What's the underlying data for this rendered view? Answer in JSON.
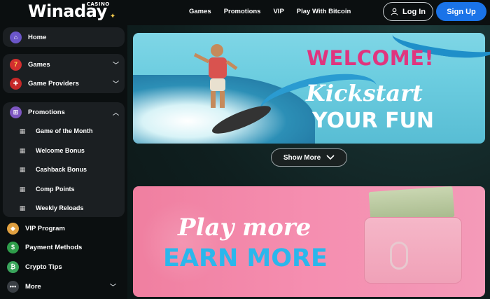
{
  "header": {
    "logo": "Winaday",
    "logo_tag": "CASINO",
    "nav": [
      "Games",
      "Promotions",
      "VIP",
      "Play With Bitcoin"
    ],
    "login_label": "Log In",
    "signup_label": "Sign Up"
  },
  "sidebar": {
    "home": "Home",
    "games": "Games",
    "game_providers": "Game Providers",
    "promotions": "Promotions",
    "promo_items": [
      "Game of the Month",
      "Welcome Bonus",
      "Cashback Bonus",
      "Comp Points",
      "Weekly Reloads"
    ],
    "vip": "VIP Program",
    "payment": "Payment Methods",
    "crypto": "Crypto Tips",
    "more": "More"
  },
  "banner1": {
    "line1": "WELCOME!",
    "line2": "Kickstart",
    "line3": "YOUR FUN"
  },
  "show_more": "Show More",
  "banner2": {
    "line1": "Play more",
    "line2": "EARN MORE"
  },
  "colors": {
    "accent": "#1a73e8",
    "welcome_pink": "#e0347e",
    "earn_blue": "#2bb7ec"
  }
}
